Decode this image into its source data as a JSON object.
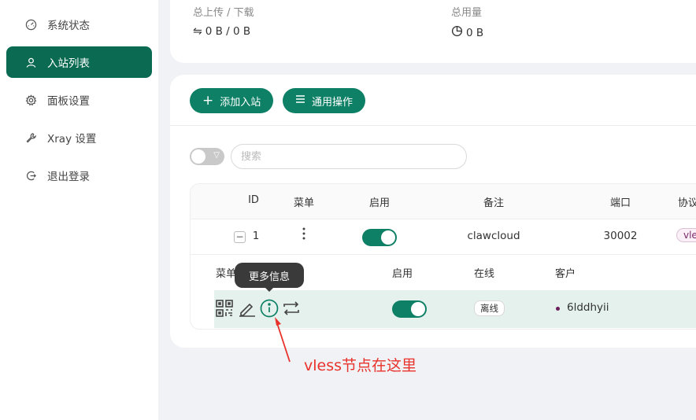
{
  "sidebar": {
    "items": [
      {
        "label": "系统状态",
        "icon": "dashboard-icon",
        "active": false
      },
      {
        "label": "入站列表",
        "icon": "user-icon",
        "active": true
      },
      {
        "label": "面板设置",
        "icon": "gear-icon",
        "active": false
      },
      {
        "label": "Xray 设置",
        "icon": "wrench-icon",
        "active": false
      },
      {
        "label": "退出登录",
        "icon": "logout-icon",
        "active": false
      }
    ]
  },
  "stats": {
    "upload_download_label": "总上传 / 下载",
    "upload_download_value": "0 B / 0 B",
    "usage_label": "总用量",
    "usage_value": "0 B"
  },
  "toolbar": {
    "add_inbound": "添加入站",
    "general_actions": "通用操作",
    "search_placeholder": "搜索"
  },
  "table": {
    "headers": {
      "id": "ID",
      "menu": "菜单",
      "enable": "启用",
      "remark": "备注",
      "port": "端口",
      "protocol": "协议"
    },
    "rows": [
      {
        "id": "1",
        "enabled": true,
        "remark": "clawcloud",
        "port": "30002",
        "protocol": "vle"
      }
    ]
  },
  "client_table": {
    "headers": {
      "menu": "菜单",
      "enable": "启用",
      "online": "在线",
      "client": "客户"
    },
    "rows": [
      {
        "enabled": true,
        "online": "离线",
        "client": "6lddhyii"
      }
    ]
  },
  "tooltip": "更多信息",
  "annotation": "vless节点在这里",
  "colors": {
    "accent": "#0e8066",
    "sidebar_active": "#0b6b52",
    "annotation": "#e8322b"
  }
}
